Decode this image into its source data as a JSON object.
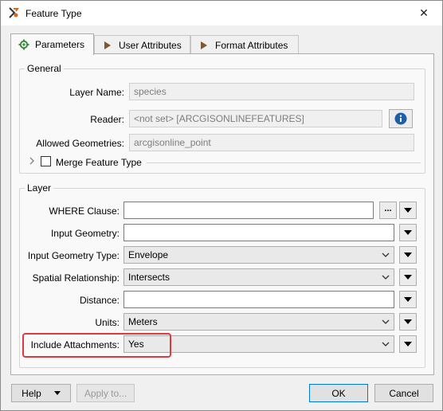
{
  "window": {
    "title": "Feature Type",
    "close_glyph": "✕"
  },
  "tabs": [
    {
      "label": "Parameters",
      "icon": "gear-icon"
    },
    {
      "label": "User Attributes",
      "icon": "tag-icon"
    },
    {
      "label": "Format Attributes",
      "icon": "tag-icon"
    }
  ],
  "general": {
    "title": "General",
    "layer_name_label": "Layer Name:",
    "layer_name_value": "species",
    "reader_label": "Reader:",
    "reader_value": "<not set> [ARCGISONLINEFEATURES]",
    "allowed_geometries_label": "Allowed Geometries:",
    "allowed_geometries_value": "arcgisonline_point",
    "merge_label": "Merge Feature Type",
    "merge_checked": false
  },
  "layer": {
    "title": "Layer",
    "where_label": "WHERE Clause:",
    "where_value": "",
    "where_button": "...",
    "input_geometry_label": "Input Geometry:",
    "input_geometry_value": "",
    "input_geometry_type_label": "Input Geometry Type:",
    "input_geometry_type_value": "Envelope",
    "spatial_relationship_label": "Spatial Relationship:",
    "spatial_relationship_value": "Intersects",
    "distance_label": "Distance:",
    "distance_value": "",
    "units_label": "Units:",
    "units_value": "Meters",
    "include_attachments_label": "Include Attachments:",
    "include_attachments_value": "Yes"
  },
  "footer": {
    "help_label": "Help",
    "apply_label": "Apply to...",
    "ok_label": "OK",
    "cancel_label": "Cancel"
  },
  "colors": {
    "highlight": "#e03a3e",
    "info_blue": "#1c5fa8",
    "tab_icon_brown": "#7a5a2e",
    "gear_green": "#3d8b3d"
  }
}
